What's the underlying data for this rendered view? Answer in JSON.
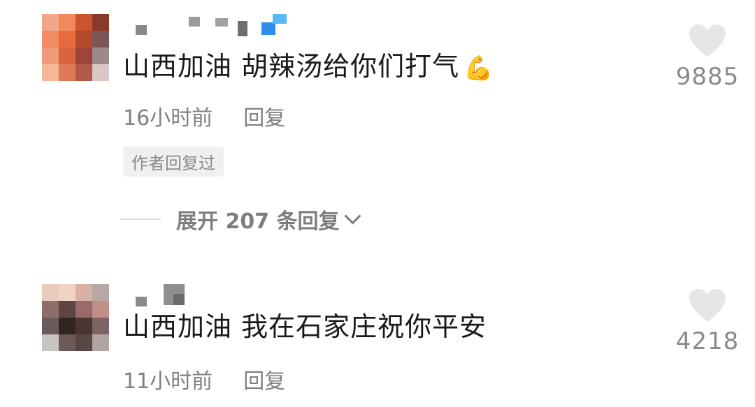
{
  "comments": [
    {
      "text": "山西加油 胡辣汤给你们打气",
      "emoji": "💪",
      "time": "16小时前",
      "reply_label": "回复",
      "author_badge": "作者回复过",
      "expand_label": "展开 207 条回复",
      "likes": "9885"
    },
    {
      "text": "山西加油 我在石家庄祝你平安",
      "time": "11小时前",
      "reply_label": "回复",
      "likes": "4218"
    }
  ],
  "colors": {
    "text_primary": "#1a1a1a",
    "text_secondary": "#808080",
    "heart_gray": "#e6e6e6",
    "badge_bg": "#f0f0f0"
  },
  "icons": [
    "heart-icon",
    "chevron-down-icon",
    "flexed-biceps-emoji"
  ]
}
